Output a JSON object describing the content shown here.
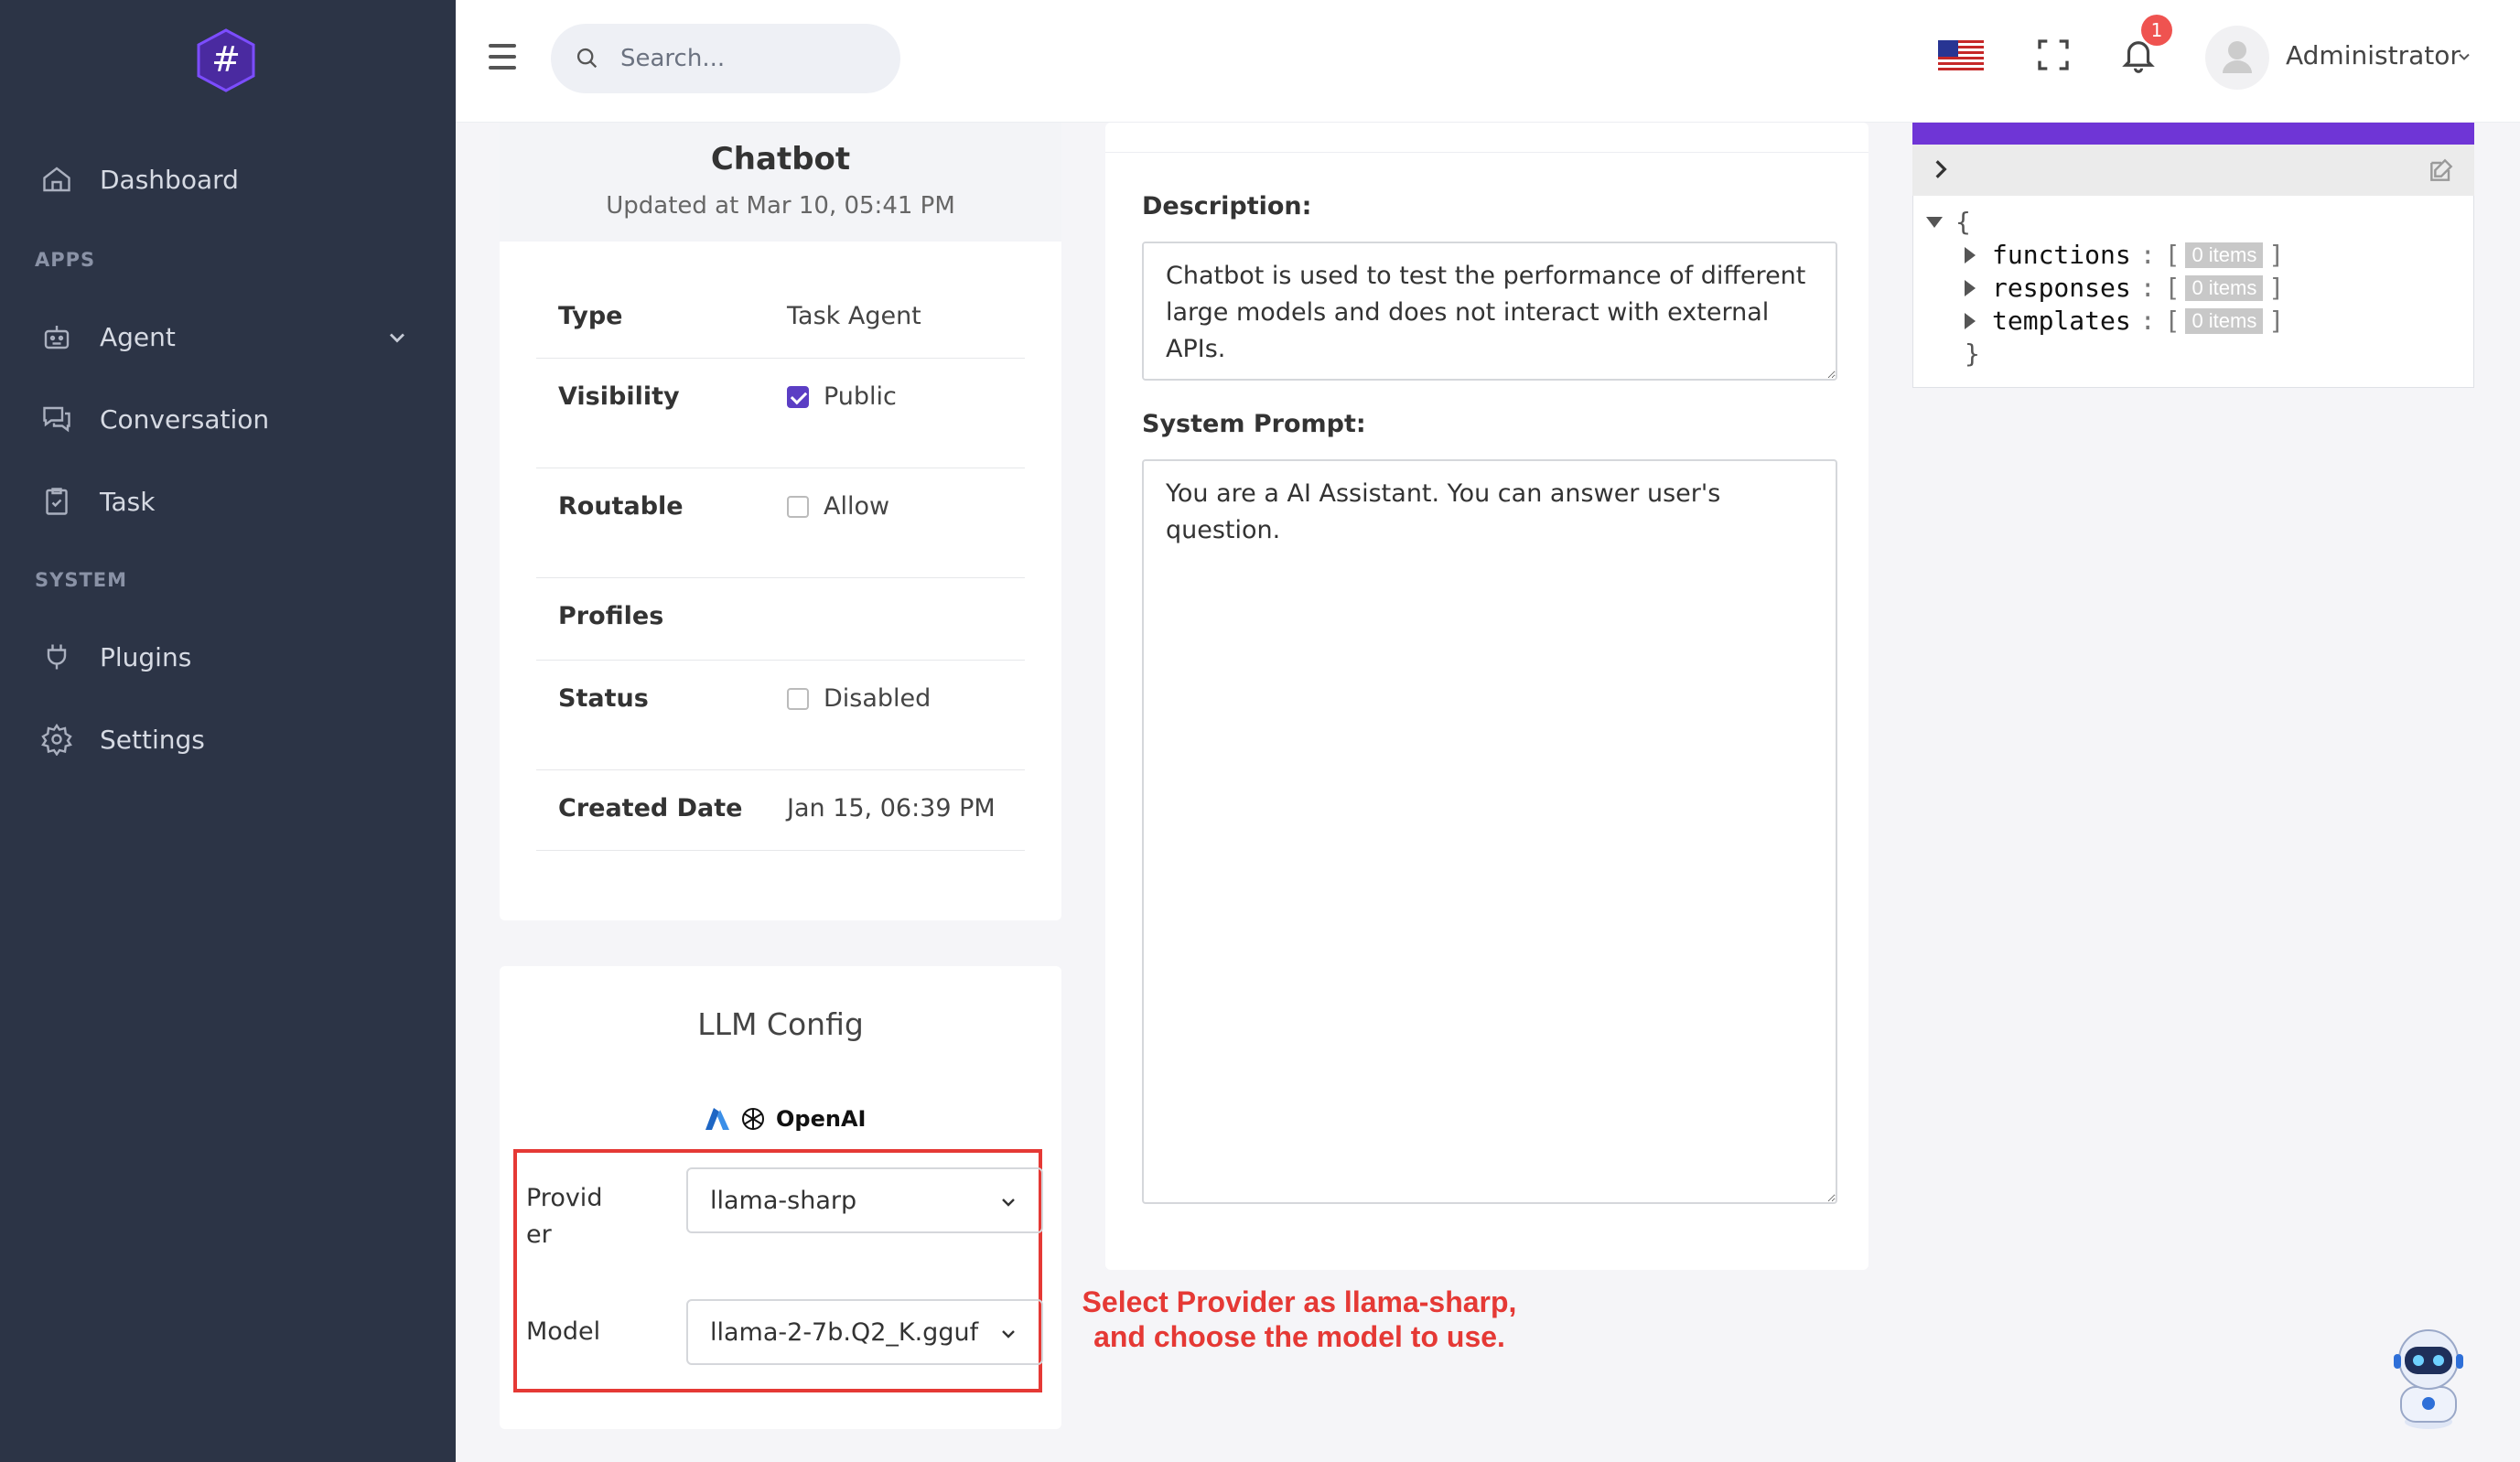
{
  "sidebar": {
    "items": {
      "dashboard": "Dashboard",
      "agent": "Agent",
      "conversation": "Conversation",
      "task": "Task",
      "plugins": "Plugins",
      "settings": "Settings"
    },
    "sections": {
      "apps": "APPS",
      "system": "SYSTEM"
    }
  },
  "header": {
    "search_placeholder": "Search...",
    "notification_count": "1",
    "user_name": "Administrator"
  },
  "agent": {
    "name": "Chatbot",
    "updated": "Updated at Mar 10, 05:41 PM",
    "fields": {
      "type_label": "Type",
      "type_value": "Task Agent",
      "visibility_label": "Visibility",
      "visibility_value": "Public",
      "visibility_checked": true,
      "routable_label": "Routable",
      "routable_value": "Allow",
      "routable_checked": false,
      "profiles_label": "Profiles",
      "status_label": "Status",
      "status_value": "Disabled",
      "status_checked": false,
      "created_label": "Created Date",
      "created_value": "Jan 15, 06:39 PM"
    }
  },
  "llm_config": {
    "title": "LLM Config",
    "logo_text": "OpenAI",
    "provider_label_line1": "Provid",
    "provider_label_line2": "er",
    "provider_value": "llama-sharp",
    "model_label": "Model",
    "model_value": "llama-2-7b.Q2_K.gguf"
  },
  "annotation": {
    "line1": "Select Provider as llama-sharp,",
    "line2": "and choose the model to use."
  },
  "details": {
    "description_label": "Description:",
    "description_value": "Chatbot is used to test the performance of different large models and does not interact with external APIs.",
    "system_prompt_label": "System Prompt:",
    "system_prompt_value": "You are a AI Assistant. You can answer user's question."
  },
  "json_viewer": {
    "open_brace": "{",
    "close_brace": "}",
    "keys": [
      "functions",
      "responses",
      "templates"
    ],
    "items_label": "0 items",
    "colon": ":",
    "open_bracket": "[",
    "close_bracket": "]"
  },
  "colors": {
    "sidebar_bg": "#2c3446",
    "accent": "#6f35d6",
    "highlight": "#e53935"
  }
}
